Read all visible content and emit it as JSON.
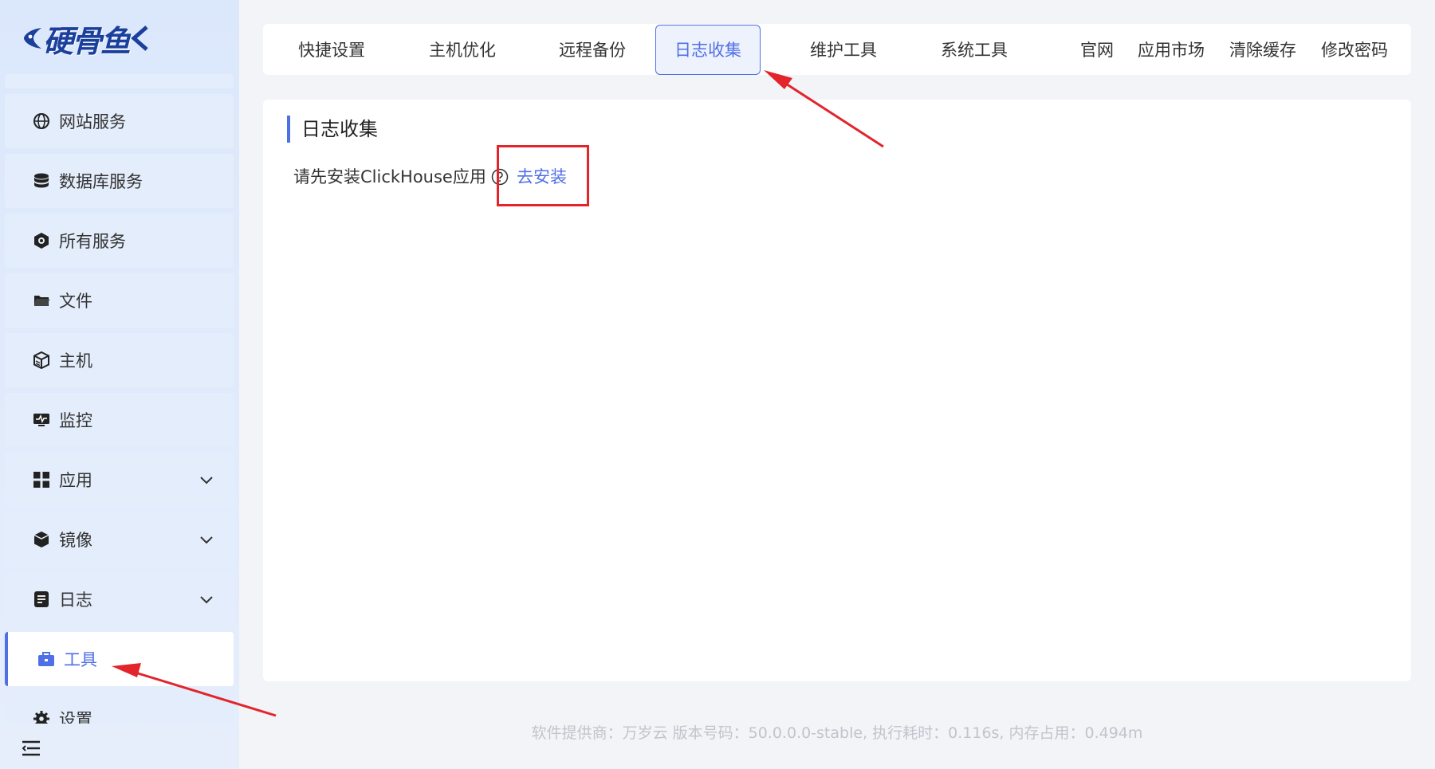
{
  "brand": {
    "logo_text": "硬骨鱼"
  },
  "sidebar": {
    "items": [
      {
        "label": "网站服务",
        "icon": "globe-icon",
        "expandable": false
      },
      {
        "label": "数据库服务",
        "icon": "database-icon",
        "expandable": false
      },
      {
        "label": "所有服务",
        "icon": "services-icon",
        "expandable": false
      },
      {
        "label": "文件",
        "icon": "folder-icon",
        "expandable": false
      },
      {
        "label": "主机",
        "icon": "server-cube-icon",
        "expandable": false
      },
      {
        "label": "监控",
        "icon": "monitor-icon",
        "expandable": false
      },
      {
        "label": "应用",
        "icon": "apps-grid-icon",
        "expandable": true
      },
      {
        "label": "镜像",
        "icon": "box-icon",
        "expandable": true
      },
      {
        "label": "日志",
        "icon": "log-icon",
        "expandable": true
      },
      {
        "label": "工具",
        "icon": "toolbox-icon",
        "expandable": false,
        "active": true
      },
      {
        "label": "设置",
        "icon": "gear-icon",
        "expandable": false
      }
    ]
  },
  "tabs": [
    {
      "label": "快捷设置"
    },
    {
      "label": "主机优化"
    },
    {
      "label": "远程备份"
    },
    {
      "label": "日志收集",
      "active": true
    },
    {
      "label": "维护工具"
    },
    {
      "label": "系统工具"
    }
  ],
  "top_links": [
    "官网",
    "应用市场",
    "清除缓存",
    "修改密码"
  ],
  "main": {
    "title": "日志收集",
    "notice": "请先安装ClickHouse应用",
    "install_link": "去安装"
  },
  "footer": {
    "text": "软件提供商：万岁云    版本号码：50.0.0.0-stable, 执行耗时：0.116s, 内存占用：0.494m"
  },
  "colors": {
    "accent": "#4f6fe6",
    "annotation": "#e3242b",
    "sidebar_bg": "#dbe7fb"
  }
}
